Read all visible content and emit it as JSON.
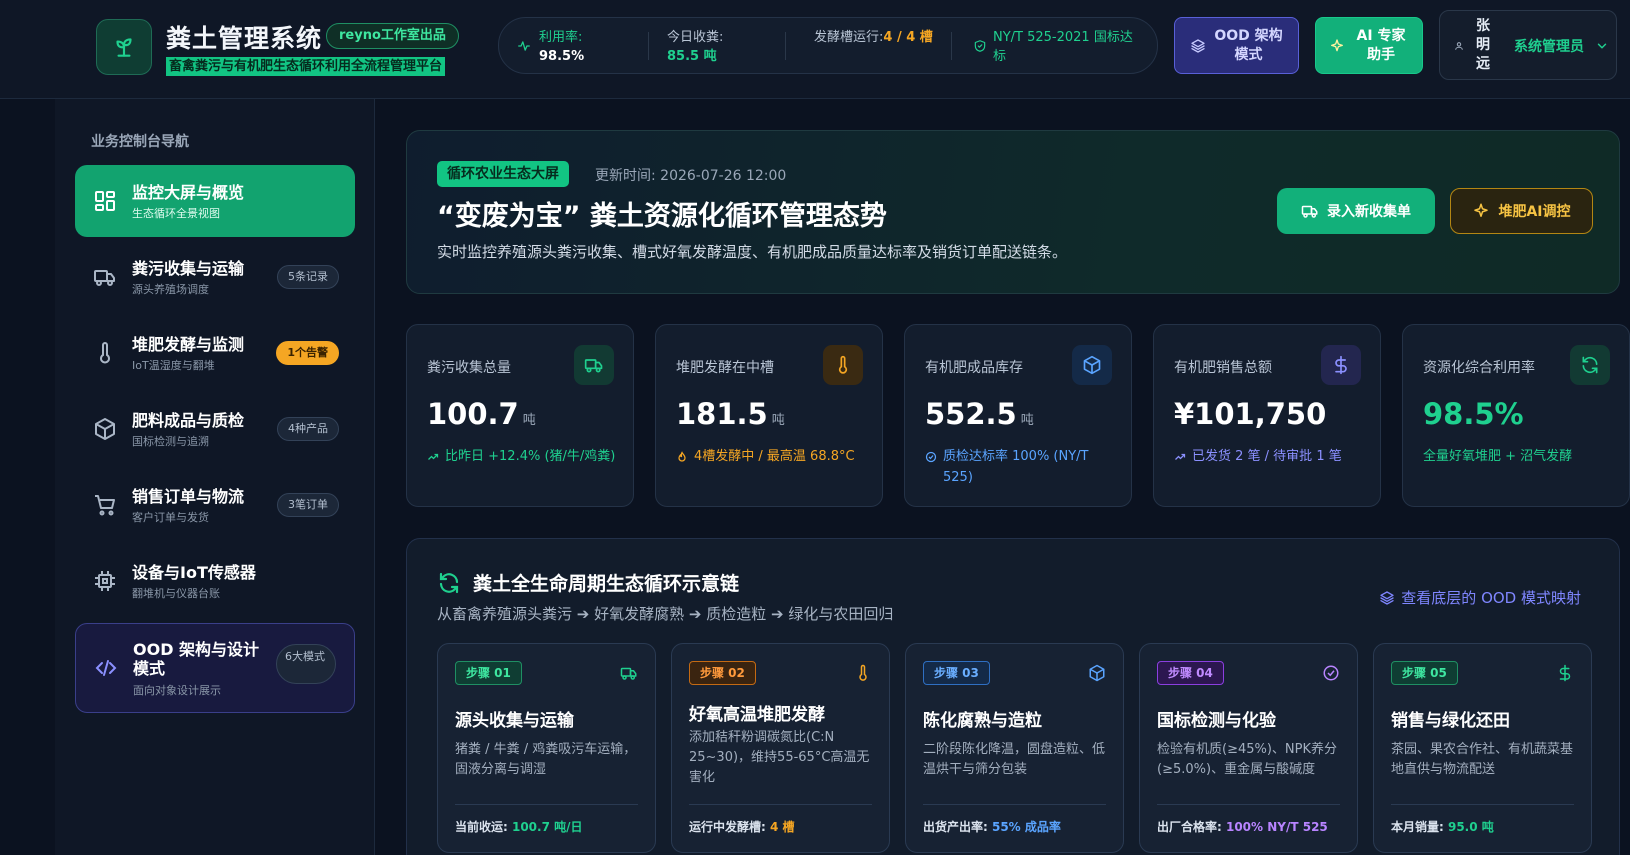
{
  "header": {
    "app_title": "粪土管理系统",
    "studio_badge": "reyno工作室出品",
    "subtitle": "畜禽粪污与有机肥生态循环利用全流程管理平台",
    "stats": [
      {
        "label": "利用率:",
        "value": "98.5%"
      },
      {
        "label": "今日收粪:",
        "value": "85.5 吨"
      },
      {
        "label": "发酵槽运行:",
        "value": "4 / 4 槽"
      },
      {
        "label": "NY/T 525-2021 国标达标",
        "value": ""
      }
    ],
    "ood_button": "OOD 架构模式",
    "ai_button": "AI 专家助手",
    "user": {
      "name": "张明远",
      "role": "系统管理员"
    }
  },
  "sidebar": {
    "heading": "业务控制台导航",
    "items": [
      {
        "title": "监控大屏与概览",
        "subtitle": "生态循环全景视图",
        "badge": ""
      },
      {
        "title": "粪污收集与运输",
        "subtitle": "源头养殖场调度",
        "badge": "5条记录"
      },
      {
        "title": "堆肥发酵与监测",
        "subtitle": "IoT温湿度与翻堆",
        "badge": "1个告警"
      },
      {
        "title": "肥料成品与质检",
        "subtitle": "国标检测与追溯",
        "badge": "4种产品"
      },
      {
        "title": "销售订单与物流",
        "subtitle": "客户订单与发货",
        "badge": "3笔订单"
      },
      {
        "title": "设备与IoT传感器",
        "subtitle": "翻堆机与仪器台账",
        "badge": ""
      },
      {
        "title": "OOD 架构与设计模式",
        "subtitle": "面向对象设计展示",
        "badge": "6大模式"
      }
    ]
  },
  "hero": {
    "tag": "循环农业生态大屏",
    "updated": "更新时间: 2026-07-26 12:00",
    "title": "“变废为宝” 粪土资源化循环管理态势",
    "desc": "实时监控养殖源头粪污收集、槽式好氧发酵温度、有机肥成品质量达标率及销货订单配送链条。",
    "btn_primary": "录入新收集单",
    "btn_secondary": "堆肥AI调控"
  },
  "kpis": [
    {
      "label": "粪污收集总量",
      "value": "100.7",
      "unit": "吨",
      "sub": "比昨日 +12.4% (猪/牛/鸡粪)",
      "icon": "truck-icon"
    },
    {
      "label": "堆肥发酵在中槽",
      "value": "181.5",
      "unit": "吨",
      "sub": "4槽发酵中 / 最高温 68.8°C",
      "icon": "thermometer-icon"
    },
    {
      "label": "有机肥成品库存",
      "value": "552.5",
      "unit": "吨",
      "sub": "质检达标率 100% (NY/T 525)",
      "icon": "box-icon"
    },
    {
      "label": "有机肥销售总额",
      "value": "¥101,750",
      "unit": "",
      "sub": "已发货 2 笔 / 待审批 1 笔",
      "icon": "dollar-icon"
    },
    {
      "label": "资源化综合利用率",
      "value": "98.5%",
      "unit": "",
      "sub": "全量好氧堆肥 + 沼气发酵",
      "icon": "cycle-icon"
    }
  ],
  "lifecycle": {
    "title": "粪土全生命周期生态循环示意链",
    "subtitle": "从畜禽养殖源头粪污 ➔ 好氧发酵腐熟 ➔ 质检造粒 ➔ 绿化与农田回归",
    "link": "查看底层的 OOD 模式映射",
    "steps": [
      {
        "tag": "步骤 01",
        "title": "源头收集与运输",
        "desc": "猪粪 / 牛粪 / 鸡粪吸污车运输，固液分离与调湿",
        "foot_label": "当前收运: ",
        "foot_value": "100.7 吨/日"
      },
      {
        "tag": "步骤 02",
        "title": "好氧高温堆肥发酵",
        "desc": "添加秸秆粉调碳氮比(C:N 25~30)，维持55-65°C高温无害化",
        "foot_label": "运行中发酵槽: ",
        "foot_value": "4 槽"
      },
      {
        "tag": "步骤 03",
        "title": "陈化腐熟与造粒",
        "desc": "二阶段陈化降温，圆盘造粒、低温烘干与筛分包装",
        "foot_label": "出货产出率: ",
        "foot_value": "55% 成品率"
      },
      {
        "tag": "步骤 04",
        "title": "国标检测与化验",
        "desc": "检验有机质(≥45%)、NPK养分(≥5.0%)、重金属与酸碱度",
        "foot_label": "出厂合格率: ",
        "foot_value": "100% NY/T 525"
      },
      {
        "tag": "步骤 05",
        "title": "销售与绿化还田",
        "desc": "茶园、果农合作社、有机蔬菜基地直供与物流配送",
        "foot_label": "本月销量: ",
        "foot_value": "95.0 吨"
      }
    ]
  }
}
